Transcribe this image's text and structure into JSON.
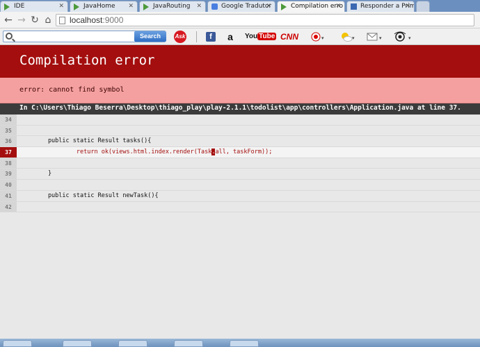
{
  "browser": {
    "tabs": [
      {
        "label": "IDE",
        "icon": "play-icon",
        "active": false
      },
      {
        "label": "JavaHome",
        "icon": "play-icon",
        "active": false
      },
      {
        "label": "JavaRouting",
        "icon": "play-icon",
        "active": false
      },
      {
        "label": "Google Tradutor",
        "icon": "translate-icon",
        "active": false
      },
      {
        "label": "Compilation erro",
        "icon": "play-icon",
        "active": true
      },
      {
        "label": "Responder a Prim",
        "icon": "page-icon",
        "active": false
      }
    ],
    "url_host": "localhost",
    "url_port": ":9000"
  },
  "ext_toolbar": {
    "search_placeholder": "",
    "search_button": "Search",
    "ask_label": "Ask",
    "facebook_label": "f",
    "amazon_label": "a",
    "youtube_you": "You",
    "youtube_tube": "Tube",
    "cnn_label": "CNN"
  },
  "error_page": {
    "title": "Compilation error",
    "message": "error: cannot find symbol",
    "location": "In C:\\Users\\Thiago Beserra\\Desktop\\thiago_play\\play-2.1.1\\todolist\\app\\controllers\\Application.java at line 37.",
    "lines": [
      {
        "num": "34",
        "code": "",
        "error": false
      },
      {
        "num": "35",
        "code": "",
        "error": false
      },
      {
        "num": "36",
        "code": "        public static Result tasks(){",
        "error": false
      },
      {
        "num": "37",
        "code_before": "                return ok(views.html.index.render(Task",
        "code_mark": ".",
        "code_after": "all, taskForm));",
        "error": true
      },
      {
        "num": "38",
        "code": "",
        "error": false
      },
      {
        "num": "39",
        "code": "        }",
        "error": false
      },
      {
        "num": "40",
        "code": "",
        "error": false
      },
      {
        "num": "41",
        "code": "        public static Result newTask(){",
        "error": false
      },
      {
        "num": "42",
        "code": "",
        "error": false
      }
    ]
  },
  "colors": {
    "header_red": "#a40e0e",
    "message_pink": "#f5a0a0",
    "location_bar": "#3b3b3b"
  }
}
